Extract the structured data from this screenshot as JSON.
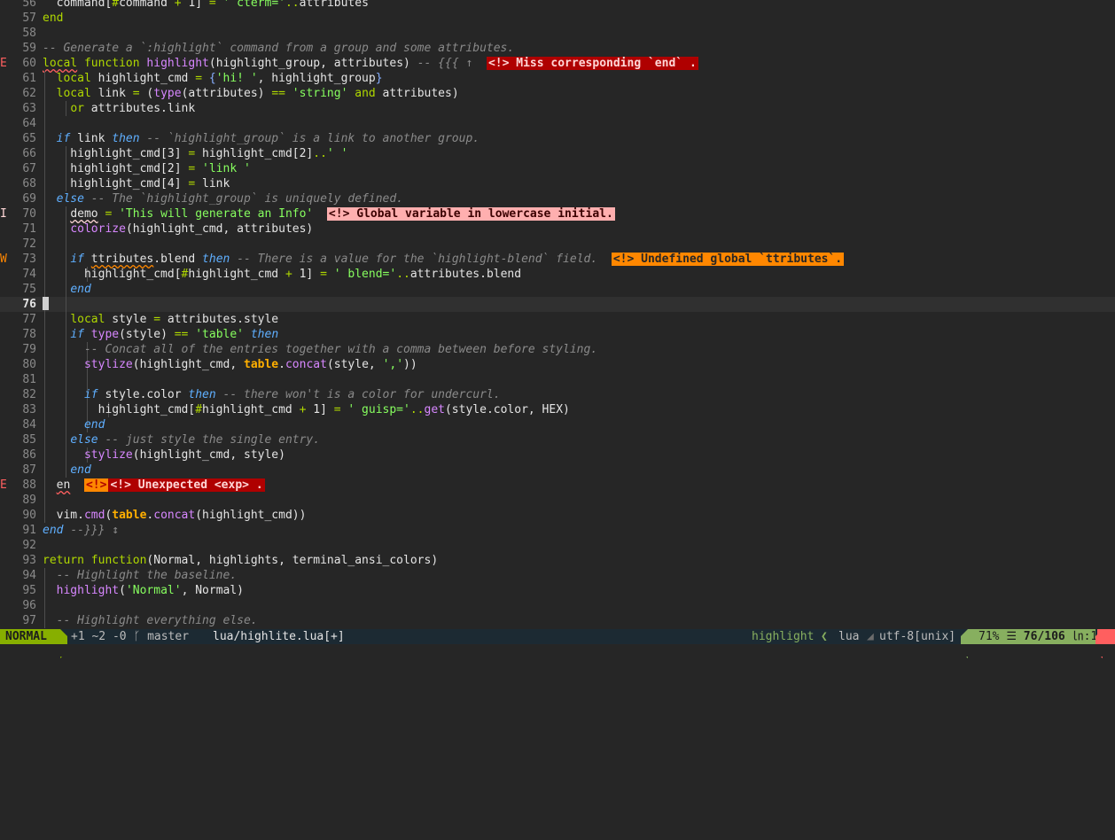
{
  "editor": {
    "lines": [
      {
        "n": "56",
        "sign": "",
        "segs": [
          [
            "  command[",
            ""
          ],
          [
            "#",
            "op"
          ],
          [
            "command ",
            ""
          ],
          [
            "+",
            "op"
          ],
          [
            " 1] ",
            ""
          ],
          [
            "=",
            "op"
          ],
          [
            " ",
            ""
          ],
          [
            "' cterm='",
            "str"
          ],
          [
            "..",
            "op"
          ],
          [
            "attributes",
            ""
          ]
        ]
      },
      {
        "n": "57",
        "sign": "",
        "segs": [
          [
            "end",
            "kw"
          ]
        ]
      },
      {
        "n": "58",
        "sign": "",
        "segs": []
      },
      {
        "n": "59",
        "sign": "",
        "segs": [
          [
            "-- Generate a `:highlight` command from a group and some attributes.",
            "cm"
          ]
        ]
      },
      {
        "n": "60",
        "sign": "E",
        "segs": [
          [
            "local",
            "kw u-red"
          ],
          [
            " ",
            ""
          ],
          [
            "function",
            "kw"
          ],
          [
            " ",
            ""
          ],
          [
            "highlight",
            "fn"
          ],
          [
            "(highlight_group, attributes) ",
            ""
          ],
          [
            "-- {{{ ↑",
            "cm"
          ],
          [
            "  ",
            ""
          ]
        ],
        "vt": {
          "text": "<!> Miss corresponding `end` .",
          "kind": "err"
        }
      },
      {
        "n": "61",
        "sign": "",
        "segs": [
          [
            "  ",
            ""
          ],
          [
            "local",
            "kw"
          ],
          [
            " highlight_cmd ",
            ""
          ],
          [
            "=",
            "op"
          ],
          [
            " ",
            ""
          ],
          [
            "{",
            "br"
          ],
          [
            "'hi! '",
            "str"
          ],
          [
            ", highlight_group",
            ""
          ],
          [
            "}",
            "br"
          ]
        ]
      },
      {
        "n": "62",
        "sign": "",
        "segs": [
          [
            "  ",
            ""
          ],
          [
            "local",
            "kw"
          ],
          [
            " link ",
            ""
          ],
          [
            "=",
            "op"
          ],
          [
            " (",
            ""
          ],
          [
            "type",
            "fn"
          ],
          [
            "(attributes) ",
            ""
          ],
          [
            "==",
            "op"
          ],
          [
            " ",
            ""
          ],
          [
            "'string'",
            "str"
          ],
          [
            " ",
            ""
          ],
          [
            "and",
            "kw"
          ],
          [
            " attributes)",
            ""
          ]
        ]
      },
      {
        "n": "63",
        "sign": "",
        "segs": [
          [
            "    ",
            ""
          ],
          [
            "or",
            "kw"
          ],
          [
            " attributes.link",
            ""
          ]
        ]
      },
      {
        "n": "64",
        "sign": "",
        "segs": []
      },
      {
        "n": "65",
        "sign": "",
        "segs": [
          [
            "  ",
            ""
          ],
          [
            "if",
            "ctl"
          ],
          [
            " link ",
            ""
          ],
          [
            "then",
            "ctl"
          ],
          [
            " ",
            ""
          ],
          [
            "-- `highlight_group` is a link to another group.",
            "cm"
          ]
        ]
      },
      {
        "n": "66",
        "sign": "",
        "segs": [
          [
            "    highlight_cmd[3] ",
            ""
          ],
          [
            "=",
            "op"
          ],
          [
            " highlight_cmd[2]",
            ""
          ],
          [
            "..",
            "op"
          ],
          [
            "' '",
            "str"
          ]
        ]
      },
      {
        "n": "67",
        "sign": "",
        "segs": [
          [
            "    highlight_cmd[2] ",
            ""
          ],
          [
            "=",
            "op"
          ],
          [
            " ",
            ""
          ],
          [
            "'link '",
            "str"
          ]
        ]
      },
      {
        "n": "68",
        "sign": "",
        "segs": [
          [
            "    highlight_cmd[4] ",
            ""
          ],
          [
            "=",
            "op"
          ],
          [
            " link",
            ""
          ]
        ]
      },
      {
        "n": "69",
        "sign": "",
        "segs": [
          [
            "  ",
            ""
          ],
          [
            "else",
            "ctl"
          ],
          [
            " ",
            ""
          ],
          [
            "-- The `highlight_group` is uniquely defined.",
            "cm"
          ]
        ]
      },
      {
        "n": "70",
        "sign": "I",
        "segs": [
          [
            "    ",
            ""
          ],
          [
            "demo",
            "u-pink"
          ],
          [
            " ",
            ""
          ],
          [
            "=",
            "op"
          ],
          [
            " ",
            ""
          ],
          [
            "'This will generate an Info'",
            "str"
          ],
          [
            "  ",
            ""
          ]
        ],
        "vt": {
          "text": "<!> Global variable in lowercase initial.",
          "kind": "info"
        }
      },
      {
        "n": "71",
        "sign": "",
        "segs": [
          [
            "    ",
            ""
          ],
          [
            "colorize",
            "fn"
          ],
          [
            "(highlight_cmd, attributes)",
            ""
          ]
        ]
      },
      {
        "n": "72",
        "sign": "",
        "segs": []
      },
      {
        "n": "73",
        "sign": "W",
        "segs": [
          [
            "    ",
            ""
          ],
          [
            "if",
            "ctl"
          ],
          [
            " ",
            ""
          ],
          [
            "ttributes",
            "u-orange"
          ],
          [
            ".blend ",
            ""
          ],
          [
            "then",
            "ctl"
          ],
          [
            " ",
            ""
          ],
          [
            "-- There is a value for the `highlight-blend` field.",
            "cm"
          ],
          [
            "  ",
            ""
          ]
        ],
        "vt": {
          "text": "<!> Undefined global `ttributes`.",
          "kind": "warn"
        }
      },
      {
        "n": "74",
        "sign": "",
        "segs": [
          [
            "      highlight_cmd[",
            ""
          ],
          [
            "#",
            "op"
          ],
          [
            "highlight_cmd ",
            ""
          ],
          [
            "+",
            "op"
          ],
          [
            " 1] ",
            ""
          ],
          [
            "=",
            "op"
          ],
          [
            " ",
            ""
          ],
          [
            "' blend='",
            "str"
          ],
          [
            "..",
            "op"
          ],
          [
            "attributes.blend",
            ""
          ]
        ]
      },
      {
        "n": "75",
        "sign": "",
        "segs": [
          [
            "    ",
            ""
          ],
          [
            "end",
            "ctl"
          ]
        ]
      },
      {
        "n": "76",
        "sign": "",
        "cursor": true,
        "segs": []
      },
      {
        "n": "77",
        "sign": "",
        "segs": [
          [
            "    ",
            ""
          ],
          [
            "local",
            "kw"
          ],
          [
            " style ",
            ""
          ],
          [
            "=",
            "op"
          ],
          [
            " attributes.style",
            ""
          ]
        ]
      },
      {
        "n": "78",
        "sign": "",
        "segs": [
          [
            "    ",
            ""
          ],
          [
            "if",
            "ctl"
          ],
          [
            " ",
            ""
          ],
          [
            "type",
            "fn"
          ],
          [
            "(style) ",
            ""
          ],
          [
            "==",
            "op"
          ],
          [
            " ",
            ""
          ],
          [
            "'table'",
            "str"
          ],
          [
            " ",
            ""
          ],
          [
            "then",
            "ctl"
          ]
        ]
      },
      {
        "n": "79",
        "sign": "",
        "segs": [
          [
            "      ",
            ""
          ],
          [
            "-- Concat all of the entries together with a comma between before styling.",
            "cm"
          ]
        ]
      },
      {
        "n": "80",
        "sign": "",
        "segs": [
          [
            "      ",
            ""
          ],
          [
            "stylize",
            "fn"
          ],
          [
            "(highlight_cmd, ",
            ""
          ],
          [
            "table",
            "bi"
          ],
          [
            ".",
            ""
          ],
          [
            "concat",
            "fn"
          ],
          [
            "(style, ",
            ""
          ],
          [
            "','",
            "str"
          ],
          [
            "))",
            ""
          ]
        ]
      },
      {
        "n": "81",
        "sign": "",
        "segs": []
      },
      {
        "n": "82",
        "sign": "",
        "segs": [
          [
            "      ",
            ""
          ],
          [
            "if",
            "ctl"
          ],
          [
            " style.color ",
            ""
          ],
          [
            "then",
            "ctl"
          ],
          [
            " ",
            ""
          ],
          [
            "-- there won't is a color for undercurl.",
            "cm"
          ]
        ]
      },
      {
        "n": "83",
        "sign": "",
        "segs": [
          [
            "        highlight_cmd[",
            ""
          ],
          [
            "#",
            "op"
          ],
          [
            "highlight_cmd ",
            ""
          ],
          [
            "+",
            "op"
          ],
          [
            " 1] ",
            ""
          ],
          [
            "=",
            "op"
          ],
          [
            " ",
            ""
          ],
          [
            "' guisp='",
            "str"
          ],
          [
            "..",
            "op"
          ],
          [
            "get",
            "fn"
          ],
          [
            "(style.color, HEX)",
            ""
          ]
        ]
      },
      {
        "n": "84",
        "sign": "",
        "segs": [
          [
            "      ",
            ""
          ],
          [
            "end",
            "ctl"
          ]
        ]
      },
      {
        "n": "85",
        "sign": "",
        "segs": [
          [
            "    ",
            ""
          ],
          [
            "else",
            "ctl"
          ],
          [
            " ",
            ""
          ],
          [
            "-- just style the single entry.",
            "cm"
          ]
        ]
      },
      {
        "n": "86",
        "sign": "",
        "segs": [
          [
            "      ",
            ""
          ],
          [
            "stylize",
            "fn"
          ],
          [
            "(highlight_cmd, style)",
            ""
          ]
        ]
      },
      {
        "n": "87",
        "sign": "",
        "segs": [
          [
            "    ",
            ""
          ],
          [
            "end",
            "ctl"
          ]
        ]
      },
      {
        "n": "88",
        "sign": "E",
        "segs": [
          [
            "  ",
            ""
          ],
          [
            "en",
            "u-red"
          ],
          [
            "  ",
            ""
          ]
        ],
        "vt": {
          "text": "<!> Unexpected <exp> .",
          "kind": "err",
          "mark": "<!>"
        }
      },
      {
        "n": "89",
        "sign": "",
        "segs": []
      },
      {
        "n": "90",
        "sign": "",
        "segs": [
          [
            "  vim.",
            ""
          ],
          [
            "cmd",
            "fn"
          ],
          [
            "(",
            ""
          ],
          [
            "table",
            "bi"
          ],
          [
            ".",
            ""
          ],
          [
            "concat",
            "fn"
          ],
          [
            "(highlight_cmd))",
            ""
          ]
        ]
      },
      {
        "n": "91",
        "sign": "",
        "segs": [
          [
            "end",
            "ctl"
          ],
          [
            " ",
            ""
          ],
          [
            "--}}} ↕",
            "cm"
          ]
        ]
      },
      {
        "n": "92",
        "sign": "",
        "segs": []
      },
      {
        "n": "93",
        "sign": "",
        "segs": [
          [
            "return",
            "kw"
          ],
          [
            " ",
            ""
          ],
          [
            "function",
            "kw"
          ],
          [
            "(Normal, highlights, terminal_ansi_colors)",
            ""
          ]
        ]
      },
      {
        "n": "94",
        "sign": "",
        "segs": [
          [
            "  ",
            ""
          ],
          [
            "-- Highlight the baseline.",
            "cm"
          ]
        ]
      },
      {
        "n": "95",
        "sign": "",
        "segs": [
          [
            "  ",
            ""
          ],
          [
            "highlight",
            "fn"
          ],
          [
            "(",
            ""
          ],
          [
            "'Normal'",
            "str"
          ],
          [
            ", Normal)",
            ""
          ]
        ]
      },
      {
        "n": "96",
        "sign": "",
        "segs": []
      },
      {
        "n": "97",
        "sign": "",
        "segs": [
          [
            "  ",
            ""
          ],
          [
            "-- Highlight everything else.",
            "cm"
          ]
        ]
      }
    ]
  },
  "statusline": {
    "mode": "NORMAL",
    "git": "+1 ~2 -0 ᚴ master",
    "file": "lua/highlite.lua[+]",
    "function": "highlight",
    "filetype": "lua",
    "encoding": "utf-8[unix]",
    "percent": "71%",
    "lines_icon": "☰",
    "position": "76/106",
    "col_icon": "㏑",
    "col": ":1"
  }
}
